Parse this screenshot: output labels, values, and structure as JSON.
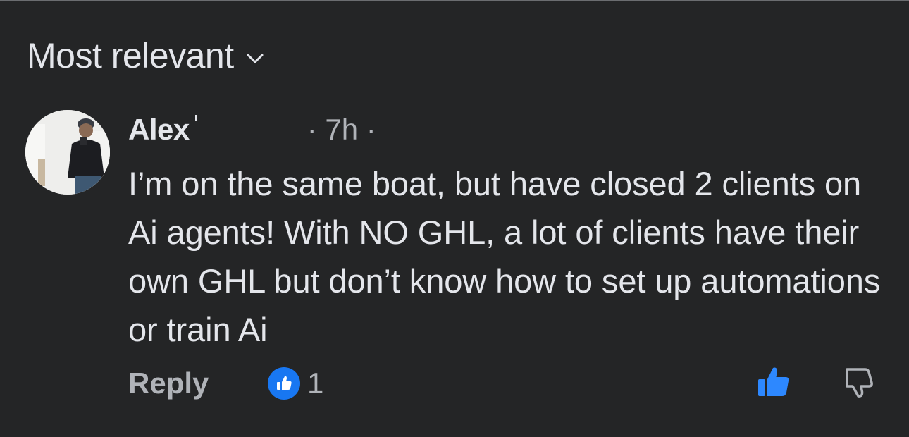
{
  "sort": {
    "label": "Most relevant",
    "icon": "chevron-down-icon"
  },
  "comment": {
    "author": "Alex",
    "time": "· 7h ·",
    "text": "I’m on the same boat, but have closed 2 clients on Ai agents! With NO GHL, a lot of clients have their own GHL but don’t know how to set up automations or train Ai",
    "avatar_icon": "user-avatar"
  },
  "actions": {
    "reply_label": "Reply",
    "reaction_count": "1",
    "reaction_icon": "thumbs-up-icon",
    "like_icon": "thumbs-up-icon",
    "dislike_icon": "thumbs-down-icon"
  },
  "colors": {
    "background": "#242526",
    "text": "#e4e6eb",
    "secondary_text": "#b0b3b8",
    "accent": "#1877f2"
  }
}
